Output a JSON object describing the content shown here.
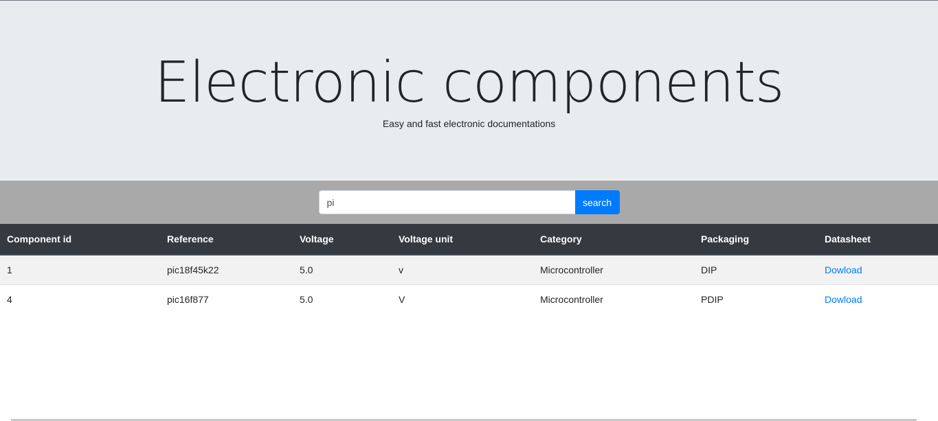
{
  "header": {
    "title": "Electronic components",
    "subtitle": "Easy and fast electronic documentations"
  },
  "search": {
    "value": "pi",
    "button_label": "search"
  },
  "table": {
    "columns": [
      "Component id",
      "Reference",
      "Voltage",
      "Voltage unit",
      "Category",
      "Packaging",
      "Datasheet"
    ],
    "rows": [
      {
        "id": "1",
        "reference": "pic18f45k22",
        "voltage": "5.0",
        "voltage_unit": "v",
        "category": "Microcontroller",
        "packaging": "DIP",
        "datasheet": "Dowload"
      },
      {
        "id": "4",
        "reference": "pic16f877",
        "voltage": "5.0",
        "voltage_unit": "V",
        "category": "Microcontroller",
        "packaging": "PDIP",
        "datasheet": "Dowload"
      }
    ]
  },
  "colors": {
    "jumbotron_bg": "#e9ecef",
    "search_bar_bg": "#a9a9a9",
    "table_header_bg": "#343a40",
    "accent": "#007bff"
  }
}
